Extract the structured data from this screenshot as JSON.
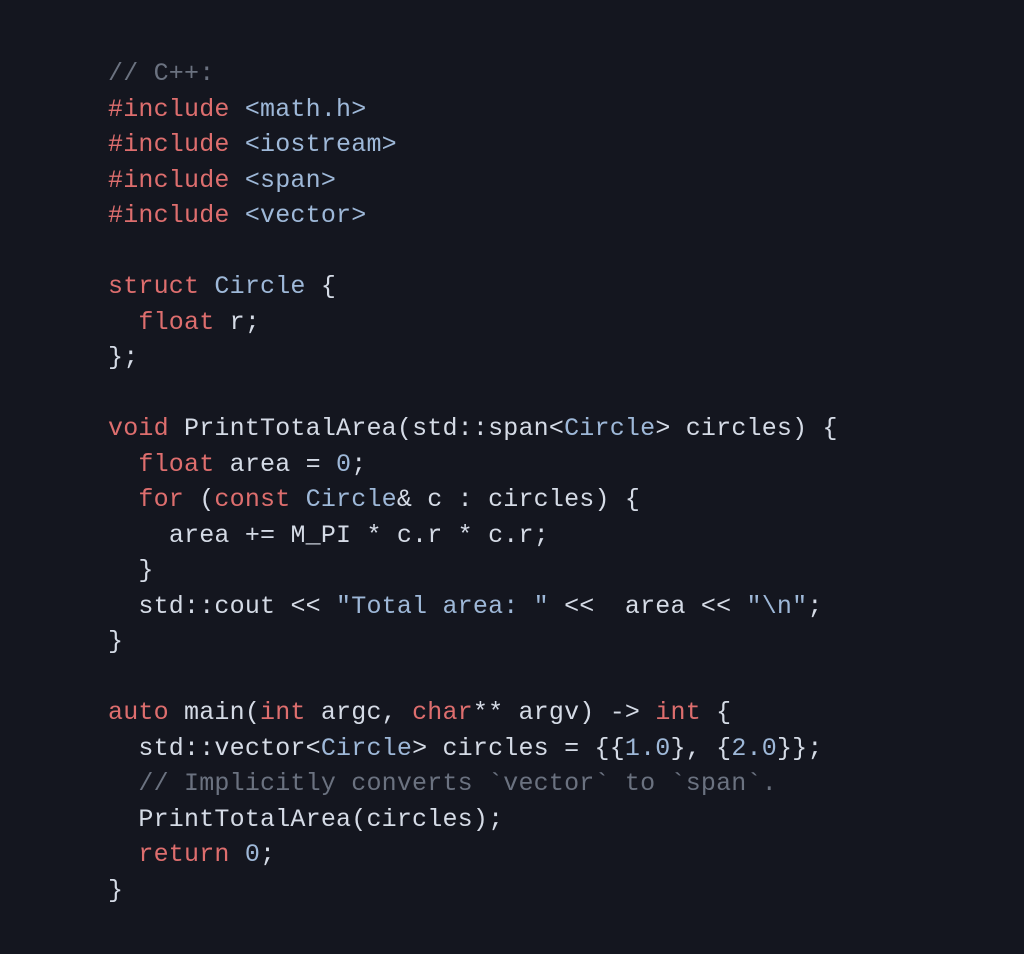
{
  "code": {
    "language": "C++",
    "lines": [
      [
        [
          "comment",
          "// C++:"
        ]
      ],
      [
        [
          "pre",
          "#include"
        ],
        [
          "space",
          " "
        ],
        [
          "string",
          "<math.h>"
        ]
      ],
      [
        [
          "pre",
          "#include"
        ],
        [
          "space",
          " "
        ],
        [
          "string",
          "<iostream>"
        ]
      ],
      [
        [
          "pre",
          "#include"
        ],
        [
          "space",
          " "
        ],
        [
          "string",
          "<span>"
        ]
      ],
      [
        [
          "pre",
          "#include"
        ],
        [
          "space",
          " "
        ],
        [
          "string",
          "<vector>"
        ]
      ],
      [
        [
          "space",
          ""
        ]
      ],
      [
        [
          "keyword",
          "struct"
        ],
        [
          "space",
          " "
        ],
        [
          "type",
          "Circle"
        ],
        [
          "space",
          " "
        ],
        [
          "op",
          "{"
        ]
      ],
      [
        [
          "space",
          "  "
        ],
        [
          "keyword",
          "float"
        ],
        [
          "space",
          " "
        ],
        [
          "ident",
          "r"
        ],
        [
          "op",
          ";"
        ]
      ],
      [
        [
          "op",
          "};"
        ]
      ],
      [
        [
          "space",
          ""
        ]
      ],
      [
        [
          "keyword",
          "void"
        ],
        [
          "space",
          " "
        ],
        [
          "func",
          "PrintTotalArea"
        ],
        [
          "op",
          "("
        ],
        [
          "ident",
          "std::span"
        ],
        [
          "op",
          "<"
        ],
        [
          "type",
          "Circle"
        ],
        [
          "op",
          ">"
        ],
        [
          "space",
          " "
        ],
        [
          "ident",
          "circles"
        ],
        [
          "op",
          ")"
        ],
        [
          "space",
          " "
        ],
        [
          "op",
          "{"
        ]
      ],
      [
        [
          "space",
          "  "
        ],
        [
          "keyword",
          "float"
        ],
        [
          "space",
          " "
        ],
        [
          "ident",
          "area"
        ],
        [
          "space",
          " "
        ],
        [
          "op",
          "="
        ],
        [
          "space",
          " "
        ],
        [
          "number",
          "0"
        ],
        [
          "op",
          ";"
        ]
      ],
      [
        [
          "space",
          "  "
        ],
        [
          "keyword",
          "for"
        ],
        [
          "space",
          " "
        ],
        [
          "op",
          "("
        ],
        [
          "keyword",
          "const"
        ],
        [
          "space",
          " "
        ],
        [
          "type",
          "Circle"
        ],
        [
          "op",
          "&"
        ],
        [
          "space",
          " "
        ],
        [
          "ident",
          "c"
        ],
        [
          "space",
          " "
        ],
        [
          "op",
          ":"
        ],
        [
          "space",
          " "
        ],
        [
          "ident",
          "circles"
        ],
        [
          "op",
          ")"
        ],
        [
          "space",
          " "
        ],
        [
          "op",
          "{"
        ]
      ],
      [
        [
          "space",
          "    "
        ],
        [
          "ident",
          "area"
        ],
        [
          "space",
          " "
        ],
        [
          "op",
          "+="
        ],
        [
          "space",
          " "
        ],
        [
          "ident",
          "M_PI"
        ],
        [
          "space",
          " "
        ],
        [
          "op",
          "*"
        ],
        [
          "space",
          " "
        ],
        [
          "ident",
          "c.r"
        ],
        [
          "space",
          " "
        ],
        [
          "op",
          "*"
        ],
        [
          "space",
          " "
        ],
        [
          "ident",
          "c.r"
        ],
        [
          "op",
          ";"
        ]
      ],
      [
        [
          "space",
          "  "
        ],
        [
          "op",
          "}"
        ]
      ],
      [
        [
          "space",
          "  "
        ],
        [
          "ident",
          "std::cout"
        ],
        [
          "space",
          " "
        ],
        [
          "op",
          "<<"
        ],
        [
          "space",
          " "
        ],
        [
          "string",
          "\"Total area: \""
        ],
        [
          "space",
          " "
        ],
        [
          "op",
          "<<"
        ],
        [
          "space",
          "  "
        ],
        [
          "ident",
          "area"
        ],
        [
          "space",
          " "
        ],
        [
          "op",
          "<<"
        ],
        [
          "space",
          " "
        ],
        [
          "string",
          "\"\\n\""
        ],
        [
          "op",
          ";"
        ]
      ],
      [
        [
          "op",
          "}"
        ]
      ],
      [
        [
          "space",
          ""
        ]
      ],
      [
        [
          "keyword",
          "auto"
        ],
        [
          "space",
          " "
        ],
        [
          "func",
          "main"
        ],
        [
          "op",
          "("
        ],
        [
          "keyword",
          "int"
        ],
        [
          "space",
          " "
        ],
        [
          "ident",
          "argc"
        ],
        [
          "op",
          ","
        ],
        [
          "space",
          " "
        ],
        [
          "keyword",
          "char"
        ],
        [
          "op",
          "**"
        ],
        [
          "space",
          " "
        ],
        [
          "ident",
          "argv"
        ],
        [
          "op",
          ")"
        ],
        [
          "space",
          " "
        ],
        [
          "op",
          "->"
        ],
        [
          "space",
          " "
        ],
        [
          "keyword",
          "int"
        ],
        [
          "space",
          " "
        ],
        [
          "op",
          "{"
        ]
      ],
      [
        [
          "space",
          "  "
        ],
        [
          "ident",
          "std::vector"
        ],
        [
          "op",
          "<"
        ],
        [
          "type",
          "Circle"
        ],
        [
          "op",
          ">"
        ],
        [
          "space",
          " "
        ],
        [
          "ident",
          "circles"
        ],
        [
          "space",
          " "
        ],
        [
          "op",
          "="
        ],
        [
          "space",
          " "
        ],
        [
          "op",
          "{{"
        ],
        [
          "number",
          "1.0"
        ],
        [
          "op",
          "},"
        ],
        [
          "space",
          " "
        ],
        [
          "op",
          "{"
        ],
        [
          "number",
          "2.0"
        ],
        [
          "op",
          "}};"
        ]
      ],
      [
        [
          "space",
          "  "
        ],
        [
          "comment",
          "// Implicitly converts `vector` to `span`."
        ]
      ],
      [
        [
          "space",
          "  "
        ],
        [
          "func",
          "PrintTotalArea"
        ],
        [
          "op",
          "("
        ],
        [
          "ident",
          "circles"
        ],
        [
          "op",
          ");"
        ]
      ],
      [
        [
          "space",
          "  "
        ],
        [
          "keyword",
          "return"
        ],
        [
          "space",
          " "
        ],
        [
          "number",
          "0"
        ],
        [
          "op",
          ";"
        ]
      ],
      [
        [
          "op",
          "}"
        ]
      ]
    ]
  }
}
